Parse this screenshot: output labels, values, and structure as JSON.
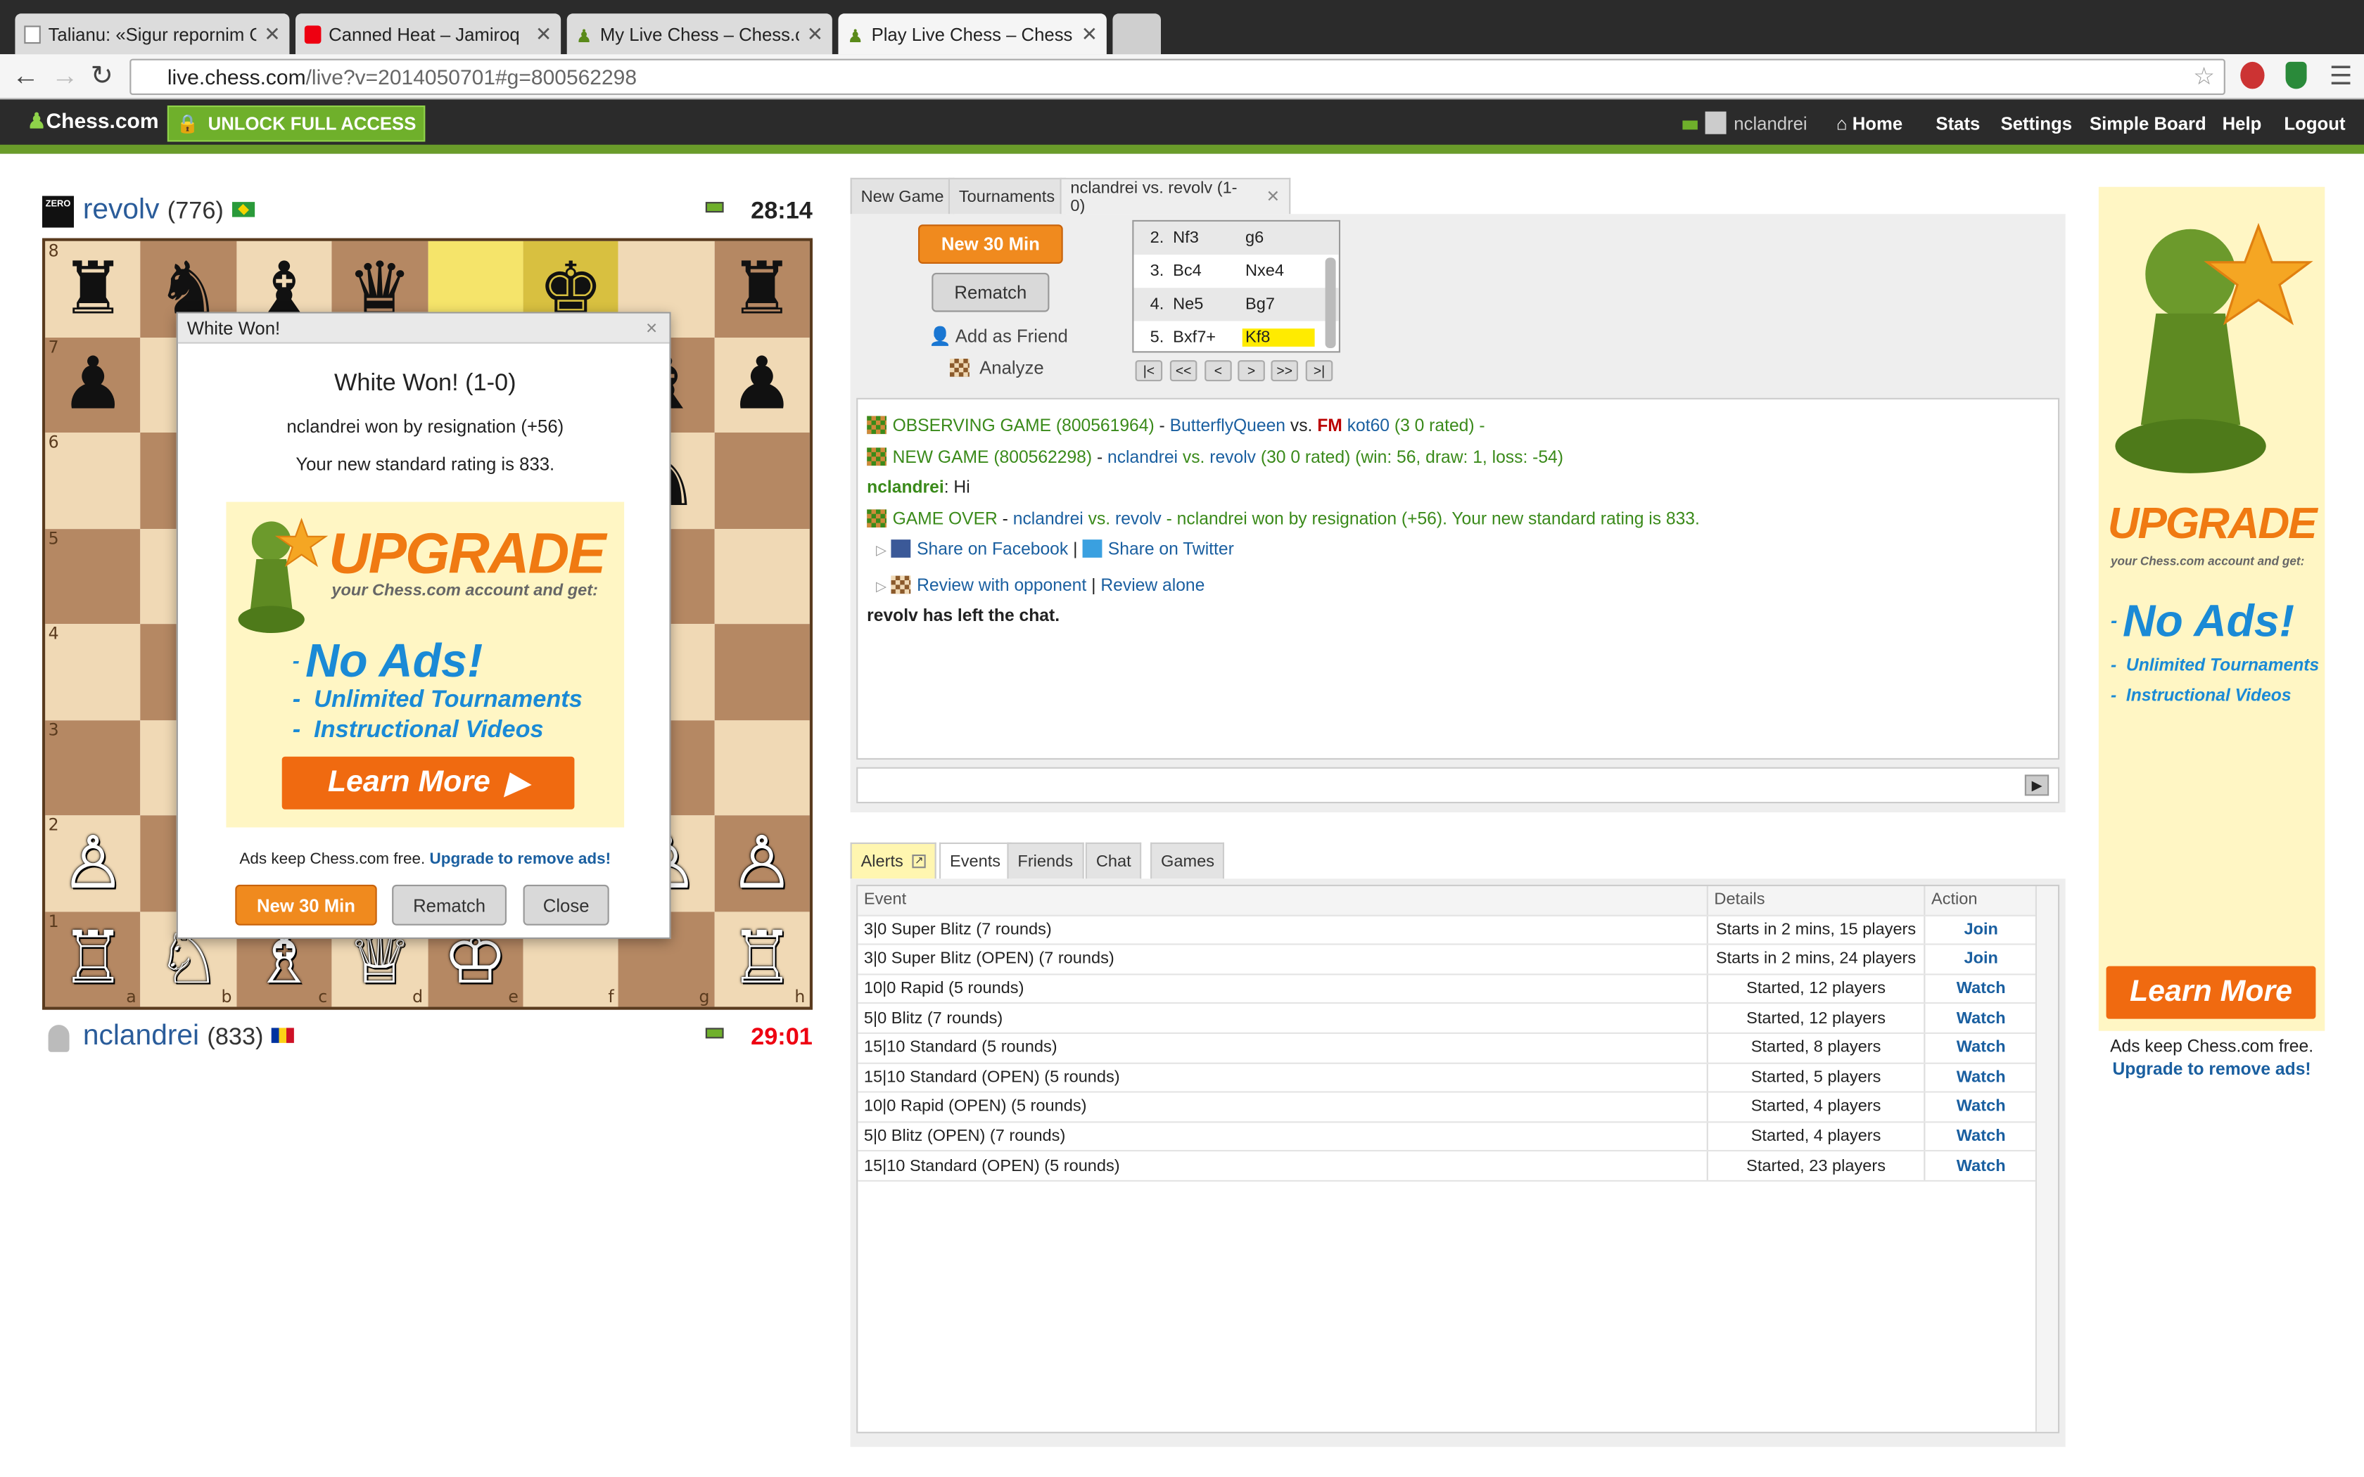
{
  "browser": {
    "tabs": [
      {
        "title": "Talianu: «Sigur repornim C"
      },
      {
        "title": "Canned Heat – Jamiroq"
      },
      {
        "title": "My Live Chess – Chess.con"
      },
      {
        "title": "Play Live Chess – Chess.co"
      }
    ],
    "url_host": "live.chess.com",
    "url_path": "/live?v=2014050701#g=800562298"
  },
  "site": {
    "logo": "Chess.com",
    "unlock": "UNLOCK FULL ACCESS",
    "username": "nclandrei",
    "nav": [
      "Home",
      "Stats",
      "Settings",
      "Simple Board",
      "Help",
      "Logout"
    ]
  },
  "players": {
    "top": {
      "name": "revolv",
      "rating": "(776)",
      "clock": "28:14",
      "badge": "ZERO"
    },
    "bottom": {
      "name": "nclandrei",
      "rating": "(833)",
      "clock": "29:01"
    }
  },
  "board": {
    "ranks": [
      "8",
      "7",
      "6",
      "5",
      "4",
      "3",
      "2",
      "1"
    ],
    "files": [
      "a",
      "b",
      "c",
      "d",
      "e",
      "f",
      "g",
      "h"
    ],
    "rows": [
      [
        "♜",
        "♞",
        "♝",
        "♛",
        "",
        "♚",
        "",
        "♜"
      ],
      [
        "♟",
        "",
        "",
        "",
        "",
        "",
        "♝",
        "♟"
      ],
      [
        "",
        "",
        "",
        "",
        "",
        "",
        "♞",
        ""
      ],
      [
        "",
        "",
        "",
        "",
        "",
        "",
        "",
        ""
      ],
      [
        "",
        "",
        "",
        "",
        "",
        "",
        "",
        ""
      ],
      [
        "",
        "",
        "",
        "",
        "",
        "",
        "",
        ""
      ],
      [
        "♙",
        "",
        "",
        "",
        "",
        "",
        "♙",
        "♙"
      ],
      [
        "♖",
        "♘",
        "♗",
        "♕",
        "♔",
        "",
        "",
        "♖"
      ]
    ],
    "highlight": [
      [
        0,
        4
      ],
      [
        0,
        5
      ]
    ]
  },
  "modal": {
    "header": "White Won!",
    "title": "White Won! (1-0)",
    "line1": "nclandrei won by resignation (+56)",
    "line2": "Your new standard rating is 833.",
    "ad": {
      "upgrade": "UPGRADE",
      "sub": "your Chess.com account and get:",
      "bullets": [
        "No Ads!",
        "Unlimited Tournaments",
        "Instructional Videos"
      ],
      "learn": "Learn More"
    },
    "footer_text": "Ads keep Chess.com free.",
    "footer_link": "Upgrade to remove ads!",
    "buttons": [
      "New 30 Min",
      "Rematch",
      "Close"
    ]
  },
  "panel": {
    "tabs": [
      "New Game",
      "Tournaments",
      "nclandrei vs. revolv (1-0)"
    ],
    "new30": "New 30 Min",
    "rematch": "Rematch",
    "add_friend": "Add as Friend",
    "analyze": "Analyze",
    "moves": [
      {
        "n": "2.",
        "w": "Nf3",
        "b": "g6"
      },
      {
        "n": "3.",
        "w": "Bc4",
        "b": "Nxe4"
      },
      {
        "n": "4.",
        "w": "Ne5",
        "b": "Bg7"
      },
      {
        "n": "5.",
        "w": "Bxf7+",
        "b": "Kf8"
      }
    ],
    "nav_buttons": [
      "|<",
      "<<",
      "<",
      ">",
      ">>",
      ">|"
    ]
  },
  "log": {
    "obs": {
      "label": "OBSERVING GAME (800561964)",
      "p1": "ButterflyQueen",
      "vs": "vs.",
      "title": "FM",
      "p2": "kot60",
      "rest": "(3 0 rated) -"
    },
    "newgame": {
      "label": "NEW GAME (800562298)",
      "p1": "nclandrei",
      "vs": "vs.",
      "p2": "revolv",
      "rest": "(30 0 rated) (win: 56, draw: 1, loss: -54)"
    },
    "chat": {
      "user": "nclandrei",
      "msg": ": Hi"
    },
    "over": {
      "label": "GAME OVER",
      "p1": "nclandrei",
      "vs": "vs.",
      "p2": "revolv",
      "rest": "- nclandrei won by resignation (+56). Your new standard rating is 833."
    },
    "share_fb": "Share on Facebook",
    "share_tw": "Share on Twitter",
    "review_opp": "Review with opponent",
    "review_alone": "Review alone",
    "sep": "|",
    "left": "revolv has left the chat."
  },
  "events": {
    "tabs": [
      "Alerts",
      "Events",
      "Friends",
      "Chat",
      "Games"
    ],
    "headers": [
      "Event",
      "Details",
      "Action"
    ],
    "rows": [
      {
        "event": "3|0 Super Blitz (7 rounds)",
        "details": "Starts in 2 mins, 15 players",
        "action": "Join"
      },
      {
        "event": "3|0 Super Blitz (OPEN) (7 rounds)",
        "details": "Starts in 2 mins, 24 players",
        "action": "Join"
      },
      {
        "event": "10|0 Rapid (5 rounds)",
        "details": "Started, 12 players",
        "action": "Watch"
      },
      {
        "event": "5|0 Blitz (7 rounds)",
        "details": "Started, 12 players",
        "action": "Watch"
      },
      {
        "event": "15|10 Standard (5 rounds)",
        "details": "Started, 8 players",
        "action": "Watch"
      },
      {
        "event": "15|10 Standard (OPEN) (5 rounds)",
        "details": "Started, 5 players",
        "action": "Watch"
      },
      {
        "event": "10|0 Rapid (OPEN) (5 rounds)",
        "details": "Started, 4 players",
        "action": "Watch"
      },
      {
        "event": "5|0 Blitz (OPEN) (7 rounds)",
        "details": "Started, 4 players",
        "action": "Watch"
      },
      {
        "event": "15|10 Standard (OPEN) (5 rounds)",
        "details": "Started, 23 players",
        "action": "Watch"
      }
    ]
  },
  "side_ad": {
    "upgrade": "UPGRADE",
    "sub": "your Chess.com account and get:",
    "bullets": [
      "No Ads!",
      "Unlimited Tournaments",
      "Instructional Videos"
    ],
    "learn": "Learn More",
    "footer_text": "Ads keep Chess.com free.",
    "footer_link": "Upgrade to remove ads!"
  },
  "colors": {
    "accent_orange": "#f08a1e",
    "brand_green": "#6a9c2a",
    "link_blue": "#1a5fa0"
  }
}
